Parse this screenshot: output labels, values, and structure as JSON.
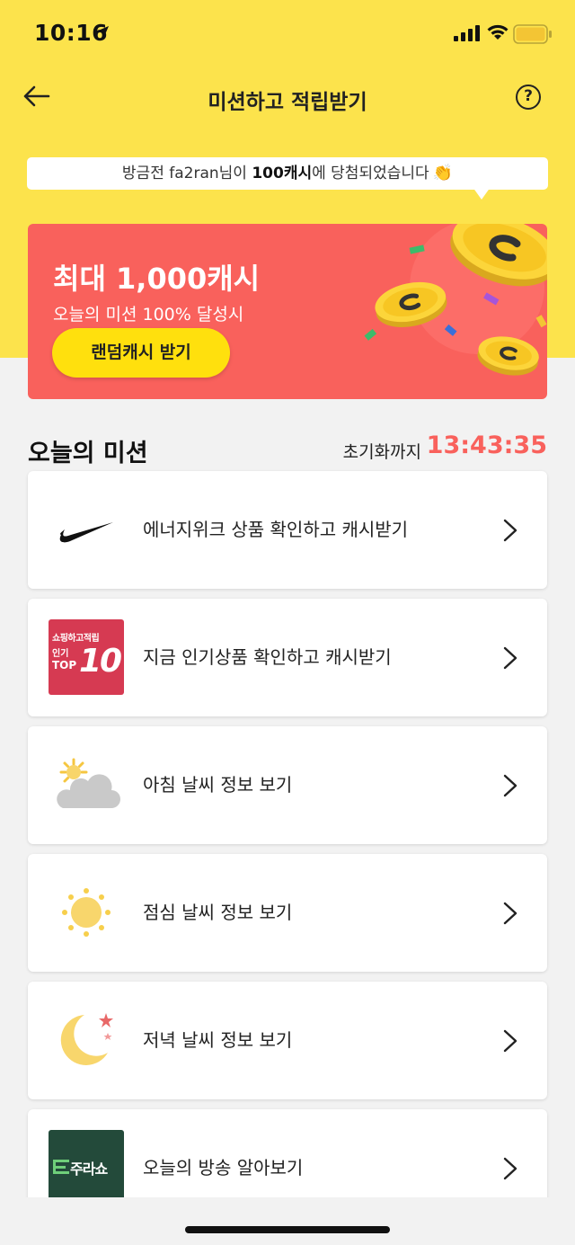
{
  "status_bar": {
    "time": "10:16"
  },
  "nav": {
    "title": "미션하고 적립받기",
    "help_label": "?"
  },
  "ticker": {
    "prefix": "방금전 fa2ran님이 ",
    "highlight": "100캐시",
    "suffix": "에 당첨되었습니다",
    "emoji": "👏"
  },
  "banner": {
    "title": "최대 1,000캐시",
    "subtitle": "오늘의 미션 100% 달성시",
    "button_label": "랜덤캐시 받기"
  },
  "missions_section": {
    "title": "오늘의 미션",
    "reset_label": "초기화까지",
    "countdown": "13:43:35"
  },
  "missions": [
    {
      "label": "에너지위크 상품 확인하고 캐시받기",
      "icon": "nike-swoosh-icon"
    },
    {
      "label": "지금 인기상품 확인하고 캐시받기",
      "icon": "top10-icon",
      "thumb_line1": "쇼핑하고적립",
      "thumb_line2": "인기",
      "thumb_line3": "TOP",
      "thumb_number": "10"
    },
    {
      "label": "아침 날씨 정보 보기",
      "icon": "sun-cloud-icon"
    },
    {
      "label": "점심 날씨 정보 보기",
      "icon": "sun-icon"
    },
    {
      "label": "저녁 날씨 정보 보기",
      "icon": "moon-stars-icon"
    },
    {
      "label": "오늘의 방송 알아보기",
      "icon": "broadcast-logo-icon",
      "thumb_text": "주라쇼"
    }
  ],
  "colors": {
    "header_yellow": "#fce34c",
    "banner_red": "#f9615c",
    "button_yellow": "#ffe00d",
    "countdown_red": "#f9615c"
  }
}
